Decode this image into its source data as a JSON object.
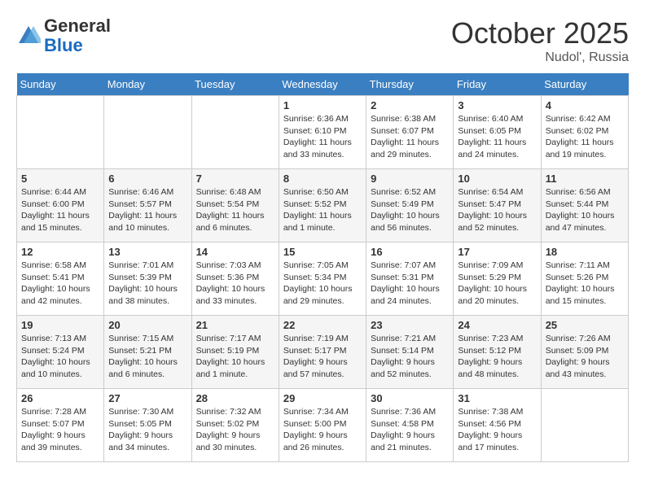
{
  "header": {
    "logo_general": "General",
    "logo_blue": "Blue",
    "month": "October 2025",
    "location": "Nudol', Russia"
  },
  "days_of_week": [
    "Sunday",
    "Monday",
    "Tuesday",
    "Wednesday",
    "Thursday",
    "Friday",
    "Saturday"
  ],
  "weeks": [
    [
      {
        "day": "",
        "info": ""
      },
      {
        "day": "",
        "info": ""
      },
      {
        "day": "",
        "info": ""
      },
      {
        "day": "1",
        "info": "Sunrise: 6:36 AM\nSunset: 6:10 PM\nDaylight: 11 hours\nand 33 minutes."
      },
      {
        "day": "2",
        "info": "Sunrise: 6:38 AM\nSunset: 6:07 PM\nDaylight: 11 hours\nand 29 minutes."
      },
      {
        "day": "3",
        "info": "Sunrise: 6:40 AM\nSunset: 6:05 PM\nDaylight: 11 hours\nand 24 minutes."
      },
      {
        "day": "4",
        "info": "Sunrise: 6:42 AM\nSunset: 6:02 PM\nDaylight: 11 hours\nand 19 minutes."
      }
    ],
    [
      {
        "day": "5",
        "info": "Sunrise: 6:44 AM\nSunset: 6:00 PM\nDaylight: 11 hours\nand 15 minutes."
      },
      {
        "day": "6",
        "info": "Sunrise: 6:46 AM\nSunset: 5:57 PM\nDaylight: 11 hours\nand 10 minutes."
      },
      {
        "day": "7",
        "info": "Sunrise: 6:48 AM\nSunset: 5:54 PM\nDaylight: 11 hours\nand 6 minutes."
      },
      {
        "day": "8",
        "info": "Sunrise: 6:50 AM\nSunset: 5:52 PM\nDaylight: 11 hours\nand 1 minute."
      },
      {
        "day": "9",
        "info": "Sunrise: 6:52 AM\nSunset: 5:49 PM\nDaylight: 10 hours\nand 56 minutes."
      },
      {
        "day": "10",
        "info": "Sunrise: 6:54 AM\nSunset: 5:47 PM\nDaylight: 10 hours\nand 52 minutes."
      },
      {
        "day": "11",
        "info": "Sunrise: 6:56 AM\nSunset: 5:44 PM\nDaylight: 10 hours\nand 47 minutes."
      }
    ],
    [
      {
        "day": "12",
        "info": "Sunrise: 6:58 AM\nSunset: 5:41 PM\nDaylight: 10 hours\nand 42 minutes."
      },
      {
        "day": "13",
        "info": "Sunrise: 7:01 AM\nSunset: 5:39 PM\nDaylight: 10 hours\nand 38 minutes."
      },
      {
        "day": "14",
        "info": "Sunrise: 7:03 AM\nSunset: 5:36 PM\nDaylight: 10 hours\nand 33 minutes."
      },
      {
        "day": "15",
        "info": "Sunrise: 7:05 AM\nSunset: 5:34 PM\nDaylight: 10 hours\nand 29 minutes."
      },
      {
        "day": "16",
        "info": "Sunrise: 7:07 AM\nSunset: 5:31 PM\nDaylight: 10 hours\nand 24 minutes."
      },
      {
        "day": "17",
        "info": "Sunrise: 7:09 AM\nSunset: 5:29 PM\nDaylight: 10 hours\nand 20 minutes."
      },
      {
        "day": "18",
        "info": "Sunrise: 7:11 AM\nSunset: 5:26 PM\nDaylight: 10 hours\nand 15 minutes."
      }
    ],
    [
      {
        "day": "19",
        "info": "Sunrise: 7:13 AM\nSunset: 5:24 PM\nDaylight: 10 hours\nand 10 minutes."
      },
      {
        "day": "20",
        "info": "Sunrise: 7:15 AM\nSunset: 5:21 PM\nDaylight: 10 hours\nand 6 minutes."
      },
      {
        "day": "21",
        "info": "Sunrise: 7:17 AM\nSunset: 5:19 PM\nDaylight: 10 hours\nand 1 minute."
      },
      {
        "day": "22",
        "info": "Sunrise: 7:19 AM\nSunset: 5:17 PM\nDaylight: 9 hours\nand 57 minutes."
      },
      {
        "day": "23",
        "info": "Sunrise: 7:21 AM\nSunset: 5:14 PM\nDaylight: 9 hours\nand 52 minutes."
      },
      {
        "day": "24",
        "info": "Sunrise: 7:23 AM\nSunset: 5:12 PM\nDaylight: 9 hours\nand 48 minutes."
      },
      {
        "day": "25",
        "info": "Sunrise: 7:26 AM\nSunset: 5:09 PM\nDaylight: 9 hours\nand 43 minutes."
      }
    ],
    [
      {
        "day": "26",
        "info": "Sunrise: 7:28 AM\nSunset: 5:07 PM\nDaylight: 9 hours\nand 39 minutes."
      },
      {
        "day": "27",
        "info": "Sunrise: 7:30 AM\nSunset: 5:05 PM\nDaylight: 9 hours\nand 34 minutes."
      },
      {
        "day": "28",
        "info": "Sunrise: 7:32 AM\nSunset: 5:02 PM\nDaylight: 9 hours\nand 30 minutes."
      },
      {
        "day": "29",
        "info": "Sunrise: 7:34 AM\nSunset: 5:00 PM\nDaylight: 9 hours\nand 26 minutes."
      },
      {
        "day": "30",
        "info": "Sunrise: 7:36 AM\nSunset: 4:58 PM\nDaylight: 9 hours\nand 21 minutes."
      },
      {
        "day": "31",
        "info": "Sunrise: 7:38 AM\nSunset: 4:56 PM\nDaylight: 9 hours\nand 17 minutes."
      },
      {
        "day": "",
        "info": ""
      }
    ]
  ]
}
